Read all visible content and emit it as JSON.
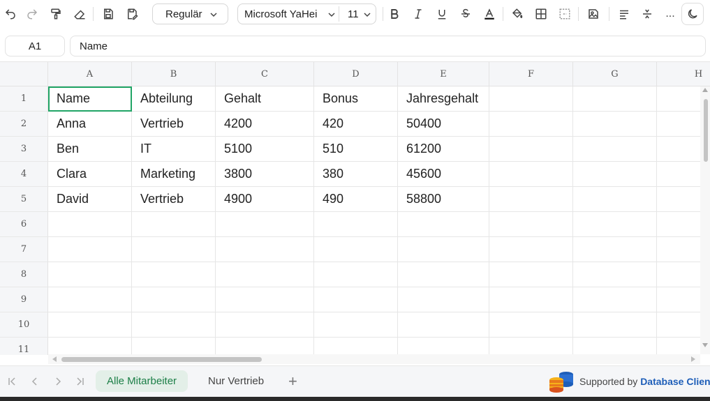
{
  "toolbar": {
    "font_style": "Regulär",
    "font_name": "Microsoft YaHei",
    "font_size": "11",
    "more": "..."
  },
  "formula_bar": {
    "cell_ref": "A1",
    "content": "Name"
  },
  "columns": [
    "A",
    "B",
    "C",
    "D",
    "E",
    "F",
    "G",
    "H"
  ],
  "rows": [
    "1",
    "2",
    "3",
    "4",
    "5",
    "6",
    "7",
    "8",
    "9",
    "10",
    "11"
  ],
  "cells": [
    [
      "Name",
      "Abteilung",
      "Gehalt",
      "Bonus",
      "Jahresgehalt"
    ],
    [
      "Anna",
      "Vertrieb",
      "4200",
      "420",
      "50400"
    ],
    [
      "Ben",
      "IT",
      "5100",
      "510",
      "61200"
    ],
    [
      "Clara",
      "Marketing",
      "3800",
      "380",
      "45600"
    ],
    [
      "David",
      "Vertrieb",
      "4900",
      "490",
      "58800"
    ]
  ],
  "sheets": {
    "active": "Alle Mitarbeiter",
    "other": "Nur Vertrieb",
    "add": "+"
  },
  "brand": {
    "prefix": "Supported by",
    "name": "Database Client"
  },
  "colors": {
    "accent": "#21a566",
    "brand": "#1e5eb8"
  }
}
